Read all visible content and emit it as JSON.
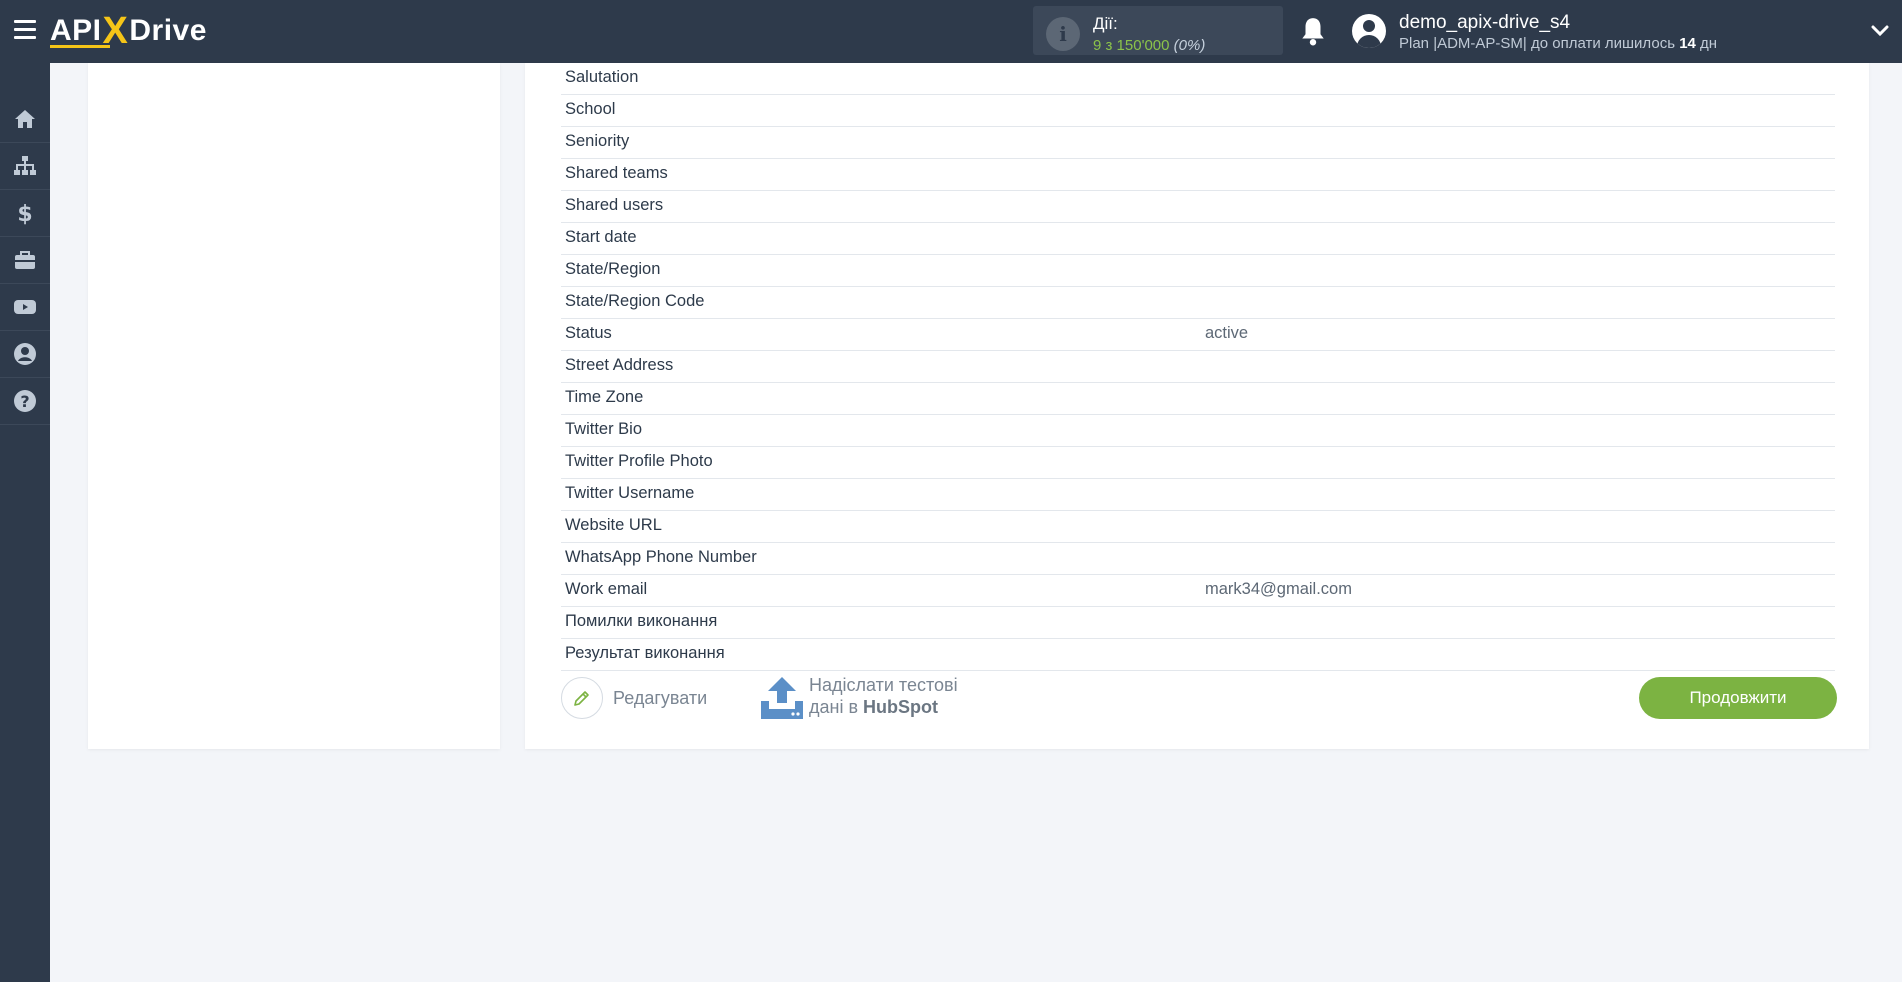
{
  "header": {
    "logo": {
      "api": "API",
      "x": "X",
      "drive": "Drive"
    },
    "actions": {
      "label": "Дії:",
      "value": "9 з 150'000",
      "percent": "(0%)"
    },
    "user": {
      "name": "demo_apix-drive_s4",
      "plan_prefix": "Plan |ADM-AP-SM| до оплати лишилось ",
      "days": "14",
      "days_suffix": " дн"
    }
  },
  "sidebar": {
    "items": [
      {
        "icon": "home-icon"
      },
      {
        "icon": "sitemap-icon"
      },
      {
        "icon": "dollar-icon"
      },
      {
        "icon": "briefcase-icon"
      },
      {
        "icon": "youtube-icon"
      },
      {
        "icon": "user-circle-icon"
      },
      {
        "icon": "help-icon"
      }
    ]
  },
  "fields": [
    {
      "key": "Salutation",
      "value": ""
    },
    {
      "key": "School",
      "value": ""
    },
    {
      "key": "Seniority",
      "value": ""
    },
    {
      "key": "Shared teams",
      "value": ""
    },
    {
      "key": "Shared users",
      "value": ""
    },
    {
      "key": "Start date",
      "value": ""
    },
    {
      "key": "State/Region",
      "value": ""
    },
    {
      "key": "State/Region Code",
      "value": ""
    },
    {
      "key": "Status",
      "value": "active"
    },
    {
      "key": "Street Address",
      "value": ""
    },
    {
      "key": "Time Zone",
      "value": ""
    },
    {
      "key": "Twitter Bio",
      "value": ""
    },
    {
      "key": "Twitter Profile Photo",
      "value": ""
    },
    {
      "key": "Twitter Username",
      "value": ""
    },
    {
      "key": "Website URL",
      "value": ""
    },
    {
      "key": "WhatsApp Phone Number",
      "value": ""
    },
    {
      "key": "Work email",
      "value": "mark34@gmail.com"
    },
    {
      "key": "Помилки виконання",
      "value": ""
    },
    {
      "key": "Результат виконання",
      "value": ""
    }
  ],
  "footer": {
    "edit_label": "Редагувати",
    "send_line1": "Надіслати тестові",
    "send_line2_prefix": "дані в ",
    "send_line2_brand": "HubSpot",
    "continue_label": "Продовжити"
  },
  "colors": {
    "topbar": "#2e3a4b",
    "accent_green": "#7cb342",
    "logo_yellow": "#f5c518",
    "upload_blue": "#5b8fc7"
  }
}
